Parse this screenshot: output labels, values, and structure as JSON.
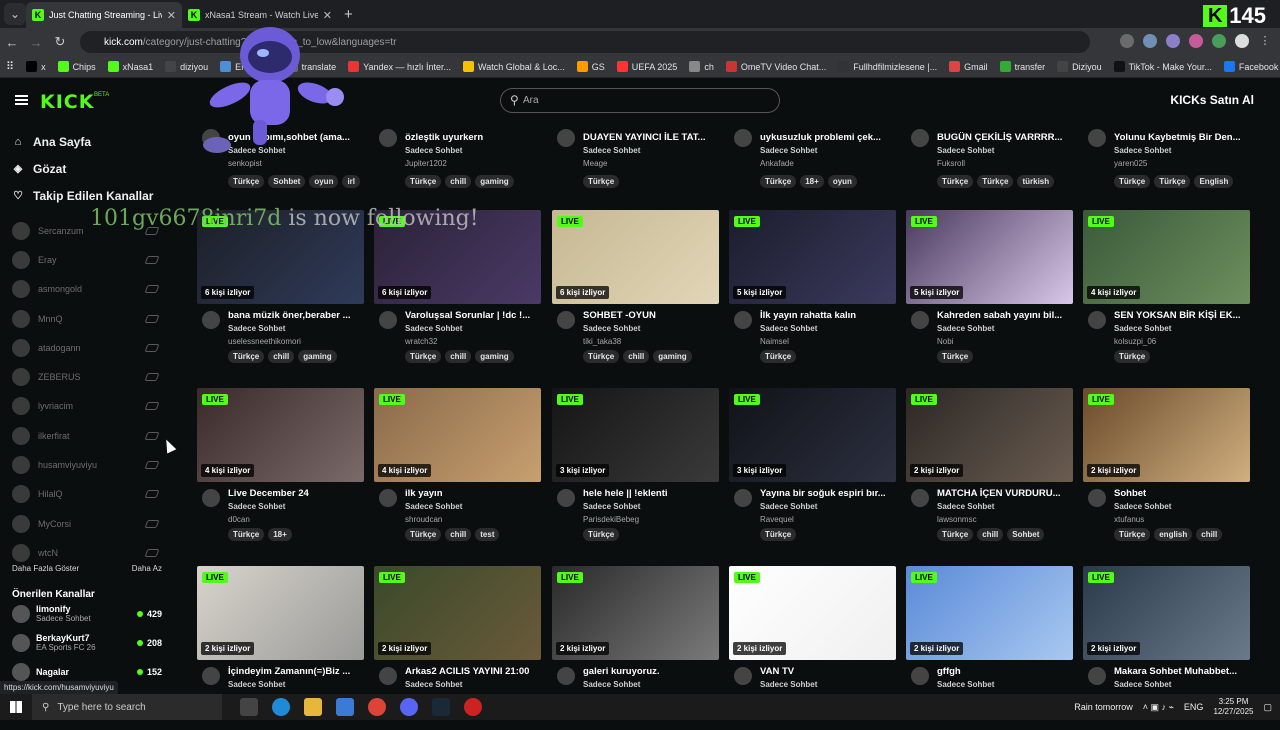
{
  "browser": {
    "tabs": [
      {
        "title": "Just Chatting Streaming - Live S",
        "active": true
      },
      {
        "title": "xNasa1 Stream - Watch Live on",
        "active": false
      }
    ],
    "counter": "145",
    "url_host": "kick.com",
    "url_path": "/category/just-chatting?s=...w_high_to_low&languages=tr",
    "bookmarks": [
      {
        "label": "x",
        "color": "#000"
      },
      {
        "label": "Chips",
        "color": "#53fc18"
      },
      {
        "label": "xNasa1",
        "color": "#53fc18"
      },
      {
        "label": "diziyou",
        "color": "#444"
      },
      {
        "label": "ENGLISH",
        "color": "#4a8fd8"
      },
      {
        "label": "translate",
        "color": "#666"
      },
      {
        "label": "Yandex — hızlı İnter...",
        "color": "#e33"
      },
      {
        "label": "Watch Global & Loc...",
        "color": "#f5c200"
      },
      {
        "label": "GS",
        "color": "#f90"
      },
      {
        "label": "UEFA 2025",
        "color": "#f33"
      },
      {
        "label": "ch",
        "color": "#888"
      },
      {
        "label": "OmeTV Video Chat...",
        "color": "#c33"
      },
      {
        "label": "Fullhdfilmizlesene |...",
        "color": "#333"
      },
      {
        "label": "Gmail",
        "color": "#d44"
      },
      {
        "label": "transfer",
        "color": "#3a3"
      },
      {
        "label": "Diziyou",
        "color": "#444"
      },
      {
        "label": "TikTok - Make Your...",
        "color": "#111"
      },
      {
        "label": "Facebook",
        "color": "#1877f2"
      }
    ]
  },
  "header": {
    "search_placeholder": "Ara",
    "kicks_label": "KICKs Satın Al"
  },
  "sidebar": {
    "nav": [
      {
        "label": "Ana Sayfa",
        "icon": "home-icon",
        "glyph": "⌂"
      },
      {
        "label": "Gözat",
        "icon": "compass-icon",
        "glyph": "◈"
      },
      {
        "label": "Takip Edilen Kanallar",
        "icon": "heart-icon",
        "glyph": "♡"
      }
    ],
    "followed": [
      "Sercanzum",
      "Eray",
      "asmongold",
      "MnnQ",
      "atadogann",
      "ZEBERUS",
      "lyvriacim",
      "ilkerfirat",
      "husamviyuviyu",
      "HilalQ",
      "MyCorsi",
      "wtcN"
    ],
    "show_more": "Daha Fazla Göster",
    "show_less": "Daha Az",
    "recommended_title": "Önerilen Kanallar",
    "recommended": [
      {
        "name": "limonify",
        "cat": "Sadece Sohbet",
        "count": "429"
      },
      {
        "name": "BerkayKurt7",
        "cat": "EA Sports FC 26",
        "count": "208"
      },
      {
        "name": "Nagalar",
        "cat": "",
        "count": "152"
      }
    ]
  },
  "overlay": {
    "user": "101gv6678inri7d",
    "msg": "is now following!"
  },
  "cards": [
    {
      "title": "oyun yapımı,sohbet (ama...",
      "cat": "Sadece Sohbet",
      "user": "senkopist",
      "tags": [
        "Türkçe",
        "Sohbet",
        "oyun",
        "irl"
      ],
      "viewers": "",
      "top": true
    },
    {
      "title": "özleştik uyurkern",
      "cat": "Sadece Sohbet",
      "user": "Jupiter1202",
      "tags": [
        "Türkçe",
        "chill",
        "gaming"
      ],
      "viewers": "",
      "top": true
    },
    {
      "title": "DUAYEN YAYINCI İLE TAT...",
      "cat": "Sadece Sohbet",
      "user": "Meage",
      "tags": [
        "Türkçe"
      ],
      "viewers": "",
      "top": true
    },
    {
      "title": "uykusuzluk problemi çek...",
      "cat": "Sadece Sohbet",
      "user": "Ankafade",
      "tags": [
        "Türkçe",
        "18+",
        "oyun"
      ],
      "viewers": "",
      "top": true
    },
    {
      "title": "BUGÜN ÇEKİLİŞ VARRRR...",
      "cat": "Sadece Sohbet",
      "user": "Fuksroll",
      "tags": [
        "Türkçe",
        "Türkçe",
        "türkish"
      ],
      "viewers": "",
      "top": true
    },
    {
      "title": "Yolunu Kaybetmiş Bir Den...",
      "cat": "Sadece Sohbet",
      "user": "yaren025",
      "tags": [
        "Türkçe",
        "Türkçe",
        "English"
      ],
      "viewers": "",
      "top": true
    },
    {
      "title": "bana müzik öner,beraber ...",
      "cat": "Sadece Sohbet",
      "user": "uselessneethikomori",
      "tags": [
        "Türkçe",
        "chill",
        "gaming"
      ],
      "viewers": "6 kişi izliyor"
    },
    {
      "title": "Varoluşsal Sorunlar | !dc !...",
      "cat": "Sadece Sohbet",
      "user": "wratch32",
      "tags": [
        "Türkçe",
        "chill",
        "gaming"
      ],
      "viewers": "6 kişi izliyor"
    },
    {
      "title": "SOHBET -OYUN",
      "cat": "Sadece Sohbet",
      "user": "tiki_taka38",
      "tags": [
        "Türkçe",
        "chill",
        "gaming"
      ],
      "viewers": "6 kişi izliyor"
    },
    {
      "title": "İlk yayın rahatta kalın",
      "cat": "Sadece Sohbet",
      "user": "Naimsel",
      "tags": [
        "Türkçe"
      ],
      "viewers": "5 kişi izliyor"
    },
    {
      "title": "Kahreden sabah yayını bil...",
      "cat": "Sadece Sohbet",
      "user": "Nobi",
      "tags": [
        "Türkçe"
      ],
      "viewers": "5 kişi izliyor"
    },
    {
      "title": "SEN YOKSAN BİR KİŞİ EK...",
      "cat": "Sadece Sohbet",
      "user": "kolsuzpi_06",
      "tags": [
        "Türkçe"
      ],
      "viewers": "4 kişi izliyor"
    },
    {
      "title": "Live December 24",
      "cat": "Sadece Sohbet",
      "user": "d0can",
      "tags": [
        "Türkçe",
        "18+"
      ],
      "viewers": "4 kişi izliyor"
    },
    {
      "title": "ilk yayın",
      "cat": "Sadece Sohbet",
      "user": "shroudcan",
      "tags": [
        "Türkçe",
        "chill",
        "test"
      ],
      "viewers": "4 kişi izliyor"
    },
    {
      "title": "hele hele || !eklenti",
      "cat": "Sadece Sohbet",
      "user": "ParisdekiBebeg",
      "tags": [
        "Türkçe"
      ],
      "viewers": "3 kişi izliyor"
    },
    {
      "title": "Yayına bir soğuk espiri bır...",
      "cat": "Sadece Sohbet",
      "user": "Ravequel",
      "tags": [
        "Türkçe"
      ],
      "viewers": "3 kişi izliyor"
    },
    {
      "title": "MATCHA İÇEN VURDURU...",
      "cat": "Sadece Sohbet",
      "user": "lawsonmsc",
      "tags": [
        "Türkçe",
        "chill",
        "Sohbet"
      ],
      "viewers": "2 kişi izliyor"
    },
    {
      "title": "Sohbet",
      "cat": "Sadece Sohbet",
      "user": "xtufanus",
      "tags": [
        "Türkçe",
        "english",
        "chill"
      ],
      "viewers": "2 kişi izliyor"
    },
    {
      "title": "İçindeyim Zamanın(=)Biz ...",
      "cat": "Sadece Sohbet",
      "user": "",
      "tags": [],
      "viewers": "2 kişi izliyor"
    },
    {
      "title": "Arkas2 ACILIS YAYINI 21:00",
      "cat": "Sadece Sohbet",
      "user": "",
      "tags": [],
      "viewers": "2 kişi izliyor"
    },
    {
      "title": "galeri kuruyoruz.",
      "cat": "Sadece Sohbet",
      "user": "",
      "tags": [],
      "viewers": "2 kişi izliyor"
    },
    {
      "title": "VAN TV",
      "cat": "Sadece Sohbet",
      "user": "",
      "tags": [],
      "viewers": "2 kişi izliyor"
    },
    {
      "title": "gffgh",
      "cat": "Sadece Sohbet",
      "user": "",
      "tags": [],
      "viewers": "2 kişi izliyor"
    },
    {
      "title": "Makara Sohbet Muhabbet...",
      "cat": "Sadece Sohbet",
      "user": "",
      "tags": [],
      "viewers": "2 kişi izliyor"
    }
  ],
  "live_label": "LIVE",
  "status_url": "https://kick.com/husamviyuviyu",
  "taskbar": {
    "search_placeholder": "Type here to search",
    "weather": "Rain tomorrow",
    "lang": "ENG",
    "time": "3:25 PM",
    "date": "12/27/2025"
  }
}
